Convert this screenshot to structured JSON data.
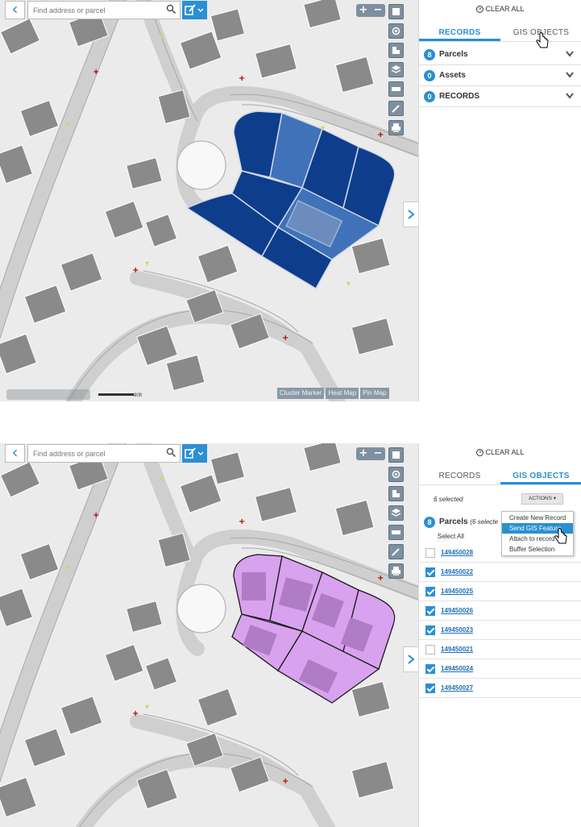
{
  "colors": {
    "accent": "#2a8fd4",
    "parcel_selected": "#0e3d8c",
    "parcel_highlight": "#3f72b8",
    "parcel_pink": "#d8a2ef",
    "building": "#8a8a8a",
    "map_bg": "#ebebeb",
    "tool_gray": "#7e8f9f"
  },
  "map": {
    "search_placeholder": "Find address or parcel",
    "back_icon": "chevron-left-icon",
    "zoom_in": "+",
    "zoom_out": "−",
    "tools": [
      "layers-toggle-icon",
      "locate-icon",
      "legend-icon",
      "basemap-icon",
      "measure-icon",
      "edit-icon",
      "print-icon"
    ],
    "scale_label": "80ft",
    "view_buttons": [
      "Cluster Marker",
      "Heat Map",
      "Pin Map"
    ]
  },
  "top": {
    "clear_all": "CLEAR ALL",
    "tabs": [
      "RECORDS",
      "GIS OBJECTS"
    ],
    "sections": [
      {
        "count": "8",
        "label": "Parcels"
      },
      {
        "count": "0",
        "label": "Assets"
      },
      {
        "count": "0",
        "label": "RECORDS"
      }
    ]
  },
  "bottom": {
    "clear_all": "CLEAR ALL",
    "tabs": [
      "RECORDS",
      "GIS OBJECTS"
    ],
    "selected_text": "6 selected",
    "actions_label": "ACTIONS ▾",
    "menu": [
      "Create New Record",
      "Send GIS Feature",
      "Attach to record",
      "Buffer Selection"
    ],
    "parcels_count": "8",
    "parcels_label": "Parcels",
    "parcels_sub": "(6 selecte",
    "select_all": "Select All",
    "parcel_rows": [
      {
        "id": "149450028",
        "checked": false
      },
      {
        "id": "149450022",
        "checked": true
      },
      {
        "id": "149450025",
        "checked": true
      },
      {
        "id": "149450026",
        "checked": true
      },
      {
        "id": "149450023",
        "checked": true
      },
      {
        "id": "149450021",
        "checked": false
      },
      {
        "id": "149450024",
        "checked": true
      },
      {
        "id": "149450027",
        "checked": true
      }
    ]
  }
}
